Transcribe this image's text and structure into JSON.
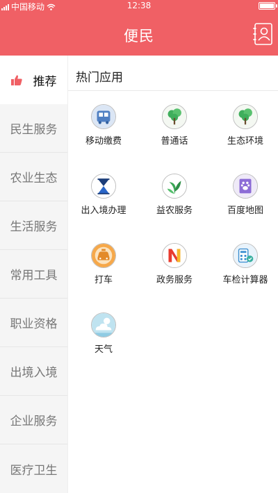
{
  "status_bar": {
    "carrier": "中国移动",
    "time": "12:38"
  },
  "header": {
    "title": "便民"
  },
  "sidebar": {
    "items": [
      {
        "label": "推荐",
        "active": true
      },
      {
        "label": "民生服务"
      },
      {
        "label": "农业生态"
      },
      {
        "label": "生活服务"
      },
      {
        "label": "常用工具"
      },
      {
        "label": "职业资格"
      },
      {
        "label": "出境入境"
      },
      {
        "label": "企业服务"
      },
      {
        "label": "医疗卫生"
      }
    ]
  },
  "main": {
    "section_title": "热门应用",
    "apps": [
      {
        "label": "移动缴费",
        "icon": "bus-icon"
      },
      {
        "label": "普通话",
        "icon": "tree-icon"
      },
      {
        "label": "生态环境",
        "icon": "tree-icon"
      },
      {
        "label": "出入境办理",
        "icon": "hourglass-icon"
      },
      {
        "label": "益农服务",
        "icon": "leaf-icon"
      },
      {
        "label": "百度地图",
        "icon": "map-icon"
      },
      {
        "label": "打车",
        "icon": "taxi-icon"
      },
      {
        "label": "政务服务",
        "icon": "gov-icon"
      },
      {
        "label": "车检计算器",
        "icon": "calculator-icon"
      },
      {
        "label": "天气",
        "icon": "weather-icon"
      }
    ]
  },
  "colors": {
    "accent": "#f06065",
    "sidebar_bg": "#f5f5f5"
  }
}
